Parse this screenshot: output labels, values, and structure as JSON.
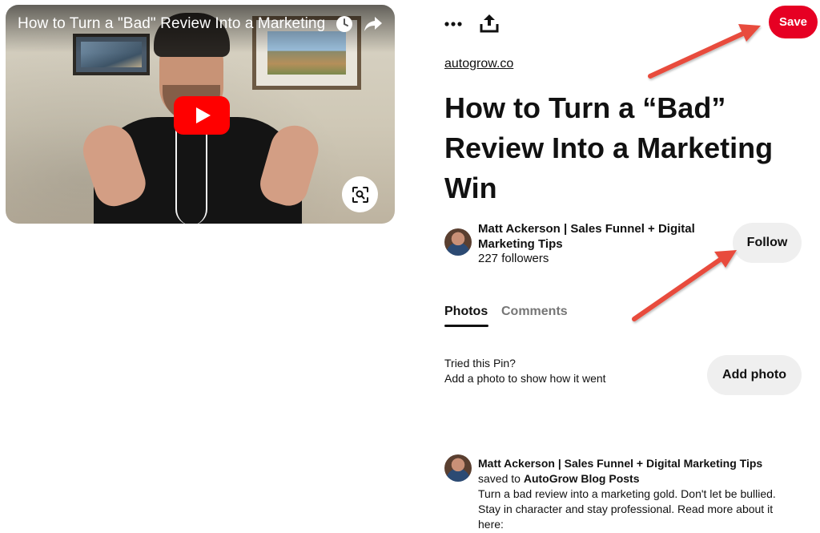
{
  "video": {
    "title": "How to Turn a \"Bad\" Review Into a Marketing ...",
    "icons": [
      "clock-icon",
      "share-arrow-icon",
      "play-icon",
      "visual-search-icon"
    ]
  },
  "toolbar": {
    "more_icon": "more-icon",
    "upload_icon": "upload-icon",
    "save_label": "Save"
  },
  "pin": {
    "source": "autogrow.co",
    "title": "How to Turn a “Bad” Review Into a Marketing Win"
  },
  "creator": {
    "name": "Matt Ackerson | Sales Funnel + Digital Marketing Tips",
    "followers": "227 followers",
    "follow_label": "Follow"
  },
  "tabs": [
    {
      "label": "Photos",
      "active": true
    },
    {
      "label": "Comments",
      "active": false
    }
  ],
  "tried": {
    "title": "Tried this Pin?",
    "subtitle": "Add a photo to show how it went",
    "button_label": "Add photo"
  },
  "activity": {
    "user": "Matt Ackerson | Sales Funnel + Digital Marketing Tips",
    "saved_prefix": "saved to ",
    "board": "AutoGrow Blog Posts",
    "description": "Turn a bad review into a marketing gold. Don't let be bullied. Stay in character and stay professional. Read more about it here:"
  },
  "colors": {
    "save": "#e60023",
    "secondary_button": "#efefef",
    "annotation_arrow": "#e84c3d",
    "play_button": "#ff0000"
  }
}
